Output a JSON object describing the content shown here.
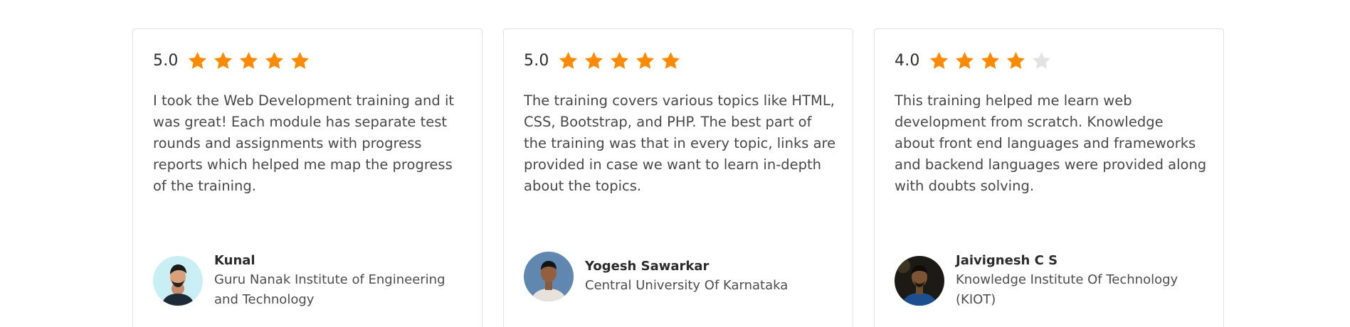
{
  "colors": {
    "star_filled": "#ff8a00",
    "star_empty": "#e3e3e3",
    "card_border": "#e2e2e2"
  },
  "reviews": [
    {
      "rating": "5.0",
      "stars_filled": 5,
      "stars_total": 5,
      "text": "I took the Web Development training and it was great! Each module has separate test rounds and assignments with progress reports which helped me map the progress of the training.",
      "author_name": "Kunal",
      "author_institution": "Guru Nanak Institute of Engineering and Technology",
      "avatar_icon": "person-avatar"
    },
    {
      "rating": "5.0",
      "stars_filled": 5,
      "stars_total": 5,
      "text": "The training covers various topics like HTML, CSS, Bootstrap, and PHP. The best part of the training was that in every topic, links are provided in case we want to learn in-depth about the topics.",
      "author_name": "Yogesh Sawarkar",
      "author_institution": "Central University Of Karnataka",
      "avatar_icon": "person-avatar"
    },
    {
      "rating": "4.0",
      "stars_filled": 4,
      "stars_total": 5,
      "text": "This training helped me learn web development from scratch. Knowledge about front end languages and frameworks and backend languages were provided along with doubts solving.",
      "author_name": "Jaivignesh C S",
      "author_institution": "Knowledge Institute Of Technology (KIOT)",
      "avatar_icon": "person-avatar"
    }
  ]
}
